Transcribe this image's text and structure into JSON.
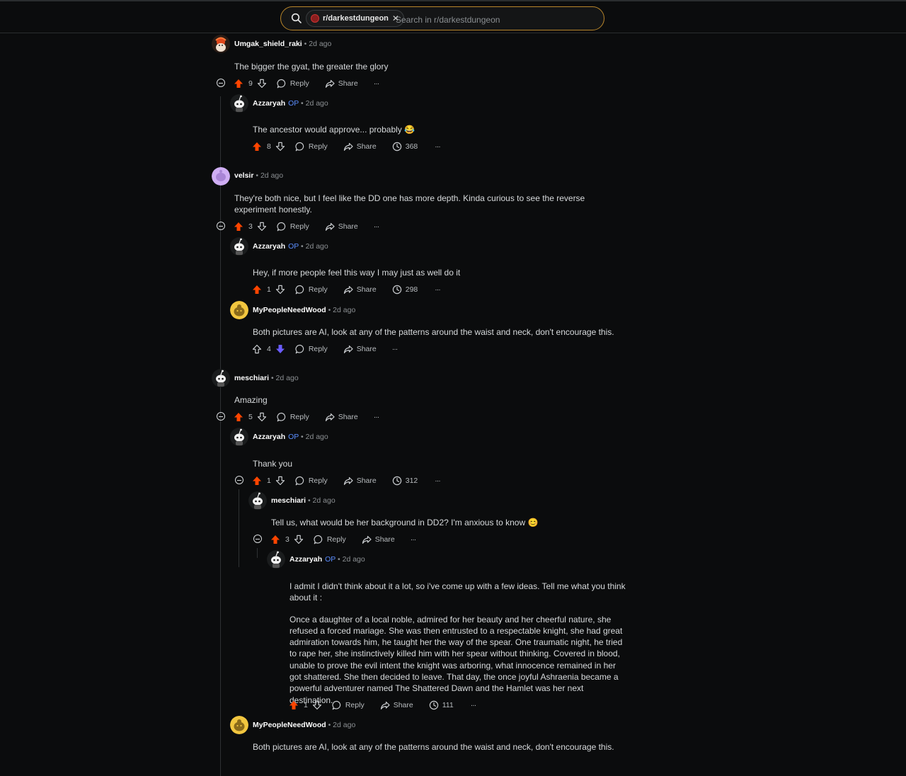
{
  "search": {
    "community": "r/darkestdungeon",
    "placeholder": "Search in r/darkestdungeon"
  },
  "labels": {
    "reply": "Reply",
    "share": "Share",
    "more": "···"
  },
  "colors": {
    "upvoted": "#ff4500",
    "downvoted": "#6a5cff",
    "op": "#5a8dff"
  },
  "comments": [
    {
      "id": "c1",
      "user": "Umgak_shield_raki",
      "op": false,
      "time": "• 2d ago",
      "avatar": "orange",
      "paragraphs": [
        "The bigger the gyat, the greater the glory"
      ],
      "score": "9",
      "vote": "up",
      "views": ""
    },
    {
      "id": "c2",
      "user": "Azzaryah",
      "op": true,
      "opLabel": "OP",
      "time": "• 2d ago",
      "avatar": "snoo",
      "paragraphs": [
        "The ancestor would approve... probably 😂"
      ],
      "score": "8",
      "vote": "up",
      "views": "368"
    },
    {
      "id": "c3",
      "user": "velsir",
      "op": false,
      "time": "• 2d ago",
      "avatar": "purple",
      "paragraphs": [
        "They're both nice, but I feel like the DD one has more depth. Kinda curious to see the reverse experiment honestly."
      ],
      "score": "3",
      "vote": "up",
      "views": ""
    },
    {
      "id": "c4",
      "user": "Azzaryah",
      "op": true,
      "opLabel": "OP",
      "time": "• 2d ago",
      "avatar": "snoo",
      "paragraphs": [
        "Hey, if more people feel this way I may just as well do it"
      ],
      "score": "1",
      "vote": "up",
      "views": "298"
    },
    {
      "id": "c5",
      "user": "MyPeopleNeedWood",
      "op": false,
      "time": "• 2d ago",
      "avatar": "yellow",
      "paragraphs": [
        "Both pictures are AI, look at any of the patterns around the waist and neck, don't encourage this."
      ],
      "score": "4",
      "vote": "down",
      "views": ""
    },
    {
      "id": "c6",
      "user": "meschiari",
      "op": false,
      "time": "• 2d ago",
      "avatar": "snoo",
      "paragraphs": [
        "Amazing"
      ],
      "score": "5",
      "vote": "up",
      "views": ""
    },
    {
      "id": "c7",
      "user": "Azzaryah",
      "op": true,
      "opLabel": "OP",
      "time": "• 2d ago",
      "avatar": "snoo",
      "paragraphs": [
        "Thank you"
      ],
      "score": "1",
      "vote": "up",
      "views": "312"
    },
    {
      "id": "c8",
      "user": "meschiari",
      "op": false,
      "time": "• 2d ago",
      "avatar": "snoo",
      "paragraphs": [
        "Tell us, what would be her background in DD2? I'm anxious to know 😊"
      ],
      "score": "3",
      "vote": "up",
      "views": ""
    },
    {
      "id": "c9",
      "user": "Azzaryah",
      "op": true,
      "opLabel": "OP",
      "time": "• 2d ago",
      "avatar": "snoo",
      "paragraphs": [
        "I admit I didn't think about it a lot, so i've come up with a few ideas. Tell me what you think about it :",
        "Once a daughter of a local noble, admired for her beauty and her cheerful nature, she refused a forced mariage. She was then entrusted to a respectable knight, she had great admiration towards him, he taught her the way of the spear. One traumatic night, he tried to rape her, she instinctively killed him with her spear without thinking. Covered in blood, unable to prove the evil intent the knight was arboring, what innocence remained in her got shattered. She then decided to leave. That day, the once joyful Ashraenia became a powerful adventurer named The Shattered Dawn and the Hamlet was her next destination."
      ],
      "score": "1",
      "vote": "up",
      "views": "111"
    },
    {
      "id": "c10",
      "user": "MyPeopleNeedWood",
      "op": false,
      "time": "• 2d ago",
      "avatar": "yellow",
      "paragraphs": [
        "Both pictures are AI, look at any of the patterns around the waist and neck, don't encourage this."
      ],
      "score": "",
      "vote": "none",
      "views": ""
    }
  ]
}
